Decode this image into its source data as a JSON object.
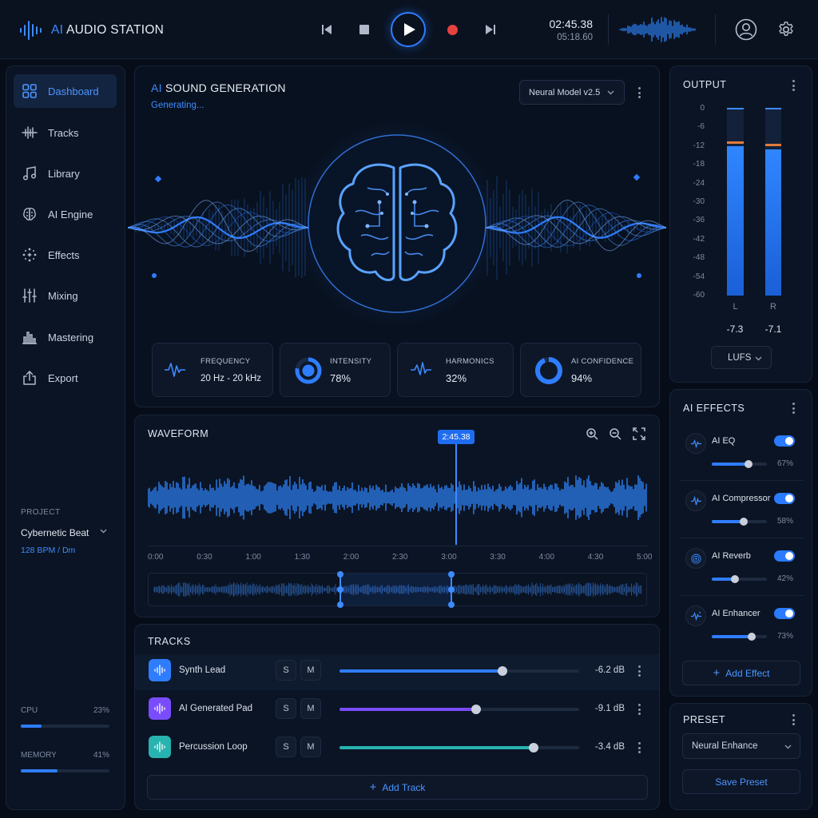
{
  "app": {
    "title_ai": "AI",
    "title_rest": "AUDIO STATION"
  },
  "transport": {
    "time_current": "02:45.38",
    "time_total": "05:18.60"
  },
  "sidebar": {
    "items": [
      {
        "label": "Dashboard",
        "icon": "grid-icon"
      },
      {
        "label": "Tracks",
        "icon": "waveform-icon"
      },
      {
        "label": "Library",
        "icon": "music-note-icon"
      },
      {
        "label": "AI Engine",
        "icon": "brain-icon"
      },
      {
        "label": "Effects",
        "icon": "sparkle-icon"
      },
      {
        "label": "Mixing",
        "icon": "sliders-icon"
      },
      {
        "label": "Mastering",
        "icon": "bars-icon"
      },
      {
        "label": "Export",
        "icon": "export-icon"
      }
    ],
    "project": {
      "label": "PROJECT",
      "name": "Cybernetic Beat",
      "meta": "128 BPM / Dm"
    },
    "cpu": {
      "label": "CPU",
      "value": "23%",
      "level": 0.23
    },
    "memory": {
      "label": "MEMORY",
      "value": "41%",
      "level": 0.41
    }
  },
  "generation": {
    "title_ai": "AI",
    "title_rest": "SOUND GENERATION",
    "status": "Generating...",
    "model": "Neural Model v2.5",
    "stats": [
      {
        "label": "FREQUENCY",
        "value": "20 Hz - 20 kHz"
      },
      {
        "label": "INTENSITY",
        "value": "78%",
        "level": 0.78
      },
      {
        "label": "HARMONICS",
        "value": "32%"
      },
      {
        "label": "AI CONFIDENCE",
        "value": "94%",
        "level": 0.94
      }
    ]
  },
  "waveform": {
    "title": "WAVEFORM",
    "playhead": "2:45.38",
    "ticks": [
      "0:00",
      "0:30",
      "1:00",
      "1:30",
      "2:00",
      "2:30",
      "3:00",
      "3:30",
      "4:00",
      "4:30",
      "5:00"
    ]
  },
  "tracks": {
    "title": "TRACKS",
    "solo": "S",
    "mute": "M",
    "items": [
      {
        "name": "Synth Lead",
        "db": "-6.2 dB",
        "level": 0.68,
        "color": "#2f7dff"
      },
      {
        "name": "AI Generated Pad",
        "db": "-9.1 dB",
        "level": 0.57,
        "color": "#7a4cff"
      },
      {
        "name": "Percussion Loop",
        "db": "-3.4 dB",
        "level": 0.81,
        "color": "#27b3b0"
      }
    ],
    "add_label": "Add Track"
  },
  "output": {
    "title": "OUTPUT",
    "scale": [
      "0",
      "-6",
      "-12",
      "-18",
      "-24",
      "-30",
      "-36",
      "-42",
      "-48",
      "-54",
      "-60"
    ],
    "left": {
      "label": "L",
      "value": "-7.3"
    },
    "right": {
      "label": "R",
      "value": "-7.1"
    },
    "unit": "LUFS"
  },
  "effects": {
    "title": "AI EFFECTS",
    "items": [
      {
        "name": "AI EQ",
        "value": "67%",
        "level": 0.67
      },
      {
        "name": "AI Compressor",
        "value": "58%",
        "level": 0.58
      },
      {
        "name": "AI Reverb",
        "value": "42%",
        "level": 0.42
      },
      {
        "name": "AI Enhancer",
        "value": "73%",
        "level": 0.73
      }
    ],
    "add_label": "Add Effect"
  },
  "preset": {
    "title": "PRESET",
    "selected": "Neural Enhance",
    "save_label": "Save Preset"
  }
}
